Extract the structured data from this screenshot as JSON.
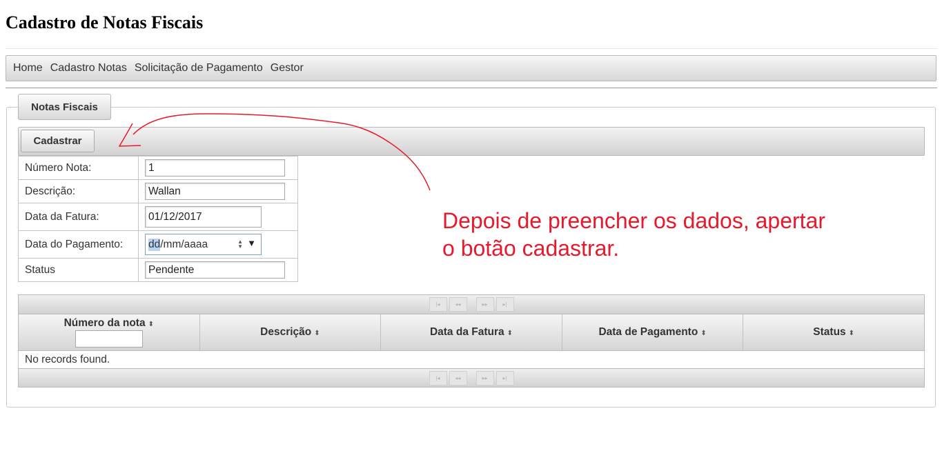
{
  "page": {
    "title": "Cadastro de Notas Fiscais"
  },
  "menu": {
    "items": [
      {
        "label": "Home"
      },
      {
        "label": "Cadastro Notas"
      },
      {
        "label": "Solicitação de Pagamento"
      },
      {
        "label": "Gestor"
      }
    ]
  },
  "panel": {
    "legend": "Notas Fiscais"
  },
  "toolbar": {
    "cadastrar_label": "Cadastrar"
  },
  "form": {
    "numero_nota": {
      "label": "Número Nota:",
      "value": "1"
    },
    "descricao": {
      "label": "Descrição:",
      "value": "Wallan"
    },
    "data_fatura": {
      "label": "Data da Fatura:",
      "value": "01/12/2017"
    },
    "data_pagamento": {
      "label": "Data do Pagamento:",
      "placeholder_selected": "dd",
      "placeholder_rest": "/mm/aaaa"
    },
    "status": {
      "label": "Status",
      "value": "Pendente"
    }
  },
  "annotation": {
    "line1": "Depois de preencher os dados, apertar",
    "line2": "o botão cadastrar.",
    "color": "#e8192c"
  },
  "table": {
    "columns": [
      {
        "label": "Número da nota"
      },
      {
        "label": "Descrição"
      },
      {
        "label": "Data da Fatura"
      },
      {
        "label": "Data de Pagamento"
      },
      {
        "label": "Status"
      }
    ],
    "empty_message": "No records found.",
    "paginator_icons": [
      "first-page-icon",
      "previous-page-icon",
      "next-page-icon",
      "last-page-icon"
    ]
  }
}
